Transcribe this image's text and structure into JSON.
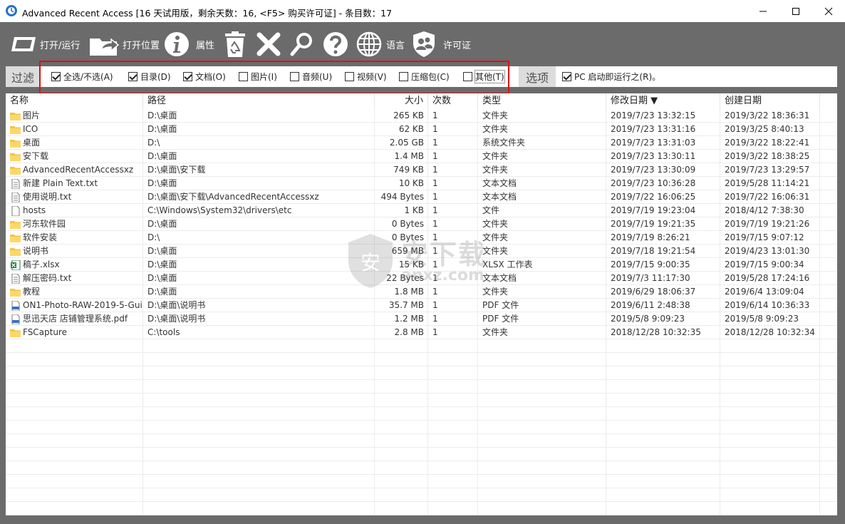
{
  "window": {
    "title": "Advanced Recent Access [16 天试用版，剩余天数：16, <F5> 购买许可证] - 条目数：17",
    "app_icon": "app-icon",
    "buttons": [
      "minimize",
      "maximize",
      "close"
    ]
  },
  "toolbar": {
    "open_run": "打开/运行",
    "open_location": "打开位置",
    "properties": "属性",
    "language": "语言",
    "license": "许可证",
    "icons": [
      "open-icon",
      "open-location-icon",
      "info-icon",
      "recycle-icon",
      "delete-icon",
      "search-icon",
      "help-icon",
      "globe-icon",
      "license-icon"
    ]
  },
  "filter": {
    "label": "过滤",
    "items": [
      {
        "label": "全选/不选(A)",
        "checked": true
      },
      {
        "label": "目录(D)",
        "checked": true
      },
      {
        "label": "文档(O)",
        "checked": true
      },
      {
        "label": "图片(I)",
        "checked": false
      },
      {
        "label": "音频(U)",
        "checked": false
      },
      {
        "label": "视频(V)",
        "checked": false
      },
      {
        "label": "压缩包(C)",
        "checked": false
      },
      {
        "label": "其他(T)",
        "checked": false
      }
    ],
    "options_label": "选项",
    "pc_startup": {
      "label": "PC 启动即运行之(R)。",
      "checked": true
    }
  },
  "columns": {
    "name": "名称",
    "path": "路径",
    "size": "大小",
    "count": "次数",
    "type": "类型",
    "modified": "修改日期 ▼",
    "created": "创建日期"
  },
  "rows": [
    {
      "icon": "folder-icon",
      "name": "图片",
      "path": "D:\\桌面",
      "size": "265 KB",
      "count": "1",
      "type": "文件夹",
      "modified": "2019/7/23 13:32:15",
      "created": "2019/3/22 18:36:31"
    },
    {
      "icon": "folder-icon",
      "name": "ICO",
      "path": "D:\\桌面",
      "size": "62 KB",
      "count": "1",
      "type": "文件夹",
      "modified": "2019/7/23 13:31:16",
      "created": "2019/3/25 8:40:13"
    },
    {
      "icon": "folder-icon",
      "name": "桌面",
      "path": "D:\\",
      "size": "2.05 GB",
      "count": "1",
      "type": "系统文件夹",
      "modified": "2019/7/23 13:31:03",
      "created": "2019/3/22 18:22:41"
    },
    {
      "icon": "folder-icon",
      "name": "安下载",
      "path": "D:\\桌面",
      "size": "1.4 MB",
      "count": "1",
      "type": "文件夹",
      "modified": "2019/7/23 13:30:11",
      "created": "2019/3/22 18:38:25"
    },
    {
      "icon": "folder-icon",
      "name": "AdvancedRecentAccessxz",
      "path": "D:\\桌面\\安下载",
      "size": "749 KB",
      "count": "1",
      "type": "文件夹",
      "modified": "2019/7/23 13:30:09",
      "created": "2019/7/23 13:29:57"
    },
    {
      "icon": "text-file-icon",
      "name": "新建 Plain Text.txt",
      "path": "D:\\桌面",
      "size": "10 KB",
      "count": "1",
      "type": "文本文档",
      "modified": "2019/7/23 10:36:28",
      "created": "2019/5/28 11:14:21"
    },
    {
      "icon": "text-file-icon",
      "name": "使用说明.txt",
      "path": "D:\\桌面\\安下载\\AdvancedRecentAccessxz",
      "size": "494 Bytes",
      "count": "1",
      "type": "文本文档",
      "modified": "2019/7/22 16:06:25",
      "created": "2019/7/22 16:06:31"
    },
    {
      "icon": "file-icon",
      "name": "hosts",
      "path": "C:\\Windows\\System32\\drivers\\etc",
      "size": "1 KB",
      "count": "1",
      "type": "文件",
      "modified": "2019/7/19 19:23:04",
      "created": "2018/4/12 7:38:30"
    },
    {
      "icon": "folder-icon",
      "name": "河东软件园",
      "path": "D:\\桌面",
      "size": "0 Bytes",
      "count": "1",
      "type": "文件夹",
      "modified": "2019/7/19 19:21:35",
      "created": "2019/7/19 19:21:26"
    },
    {
      "icon": "folder-icon",
      "name": "软件安装",
      "path": "D:\\",
      "size": "0 Bytes",
      "count": "1",
      "type": "文件夹",
      "modified": "2019/7/19 8:26:21",
      "created": "2019/7/15 9:07:12"
    },
    {
      "icon": "folder-icon",
      "name": "说明书",
      "path": "D:\\桌面",
      "size": "659 MB",
      "count": "1",
      "type": "文件夹",
      "modified": "2019/7/18 19:21:54",
      "created": "2019/4/23 13:01:30"
    },
    {
      "icon": "excel-file-icon",
      "name": "稿子.xlsx",
      "path": "D:\\桌面",
      "size": "15 KB",
      "count": "1",
      "type": "XLSX 工作表",
      "modified": "2019/7/15 9:00:35",
      "created": "2019/7/15 9:00:34"
    },
    {
      "icon": "text-file-icon",
      "name": "解压密码.txt",
      "path": "D:\\桌面",
      "size": "22 Bytes",
      "count": "1",
      "type": "文本文档",
      "modified": "2019/7/3 11:17:30",
      "created": "2019/5/28 17:24:16"
    },
    {
      "icon": "folder-icon",
      "name": "教程",
      "path": "D:\\桌面",
      "size": "1.8 MB",
      "count": "1",
      "type": "文件夹",
      "modified": "2019/6/29 18:06:37",
      "created": "2019/6/4 13:09:04"
    },
    {
      "icon": "pdf-file-icon",
      "name": "ON1-Photo-RAW-2019-5-Gui...",
      "path": "D:\\桌面\\说明书",
      "size": "35.7 MB",
      "count": "1",
      "type": "PDF 文件",
      "modified": "2019/6/11 2:48:38",
      "created": "2019/6/14 10:36:33"
    },
    {
      "icon": "pdf-file-icon",
      "name": "思迅天店 店铺管理系统.pdf",
      "path": "D:\\桌面\\说明书",
      "size": "1.2 MB",
      "count": "1",
      "type": "PDF 文件",
      "modified": "2019/5/8 9:09:23",
      "created": "2019/5/8 9:09:23"
    },
    {
      "icon": "folder-icon",
      "name": "FSCapture",
      "path": "C:\\tools",
      "size": "2.8 MB",
      "count": "1",
      "type": "文件夹",
      "modified": "2018/12/28 10:32:35",
      "created": "2018/12/28 10:32:34"
    }
  ],
  "watermark": {
    "text": "安下载",
    "sub": "anxz.com"
  },
  "colors": {
    "toolbar_bg": "#6b6b6b",
    "highlight": "#e01010",
    "folder": "#f5c342"
  }
}
